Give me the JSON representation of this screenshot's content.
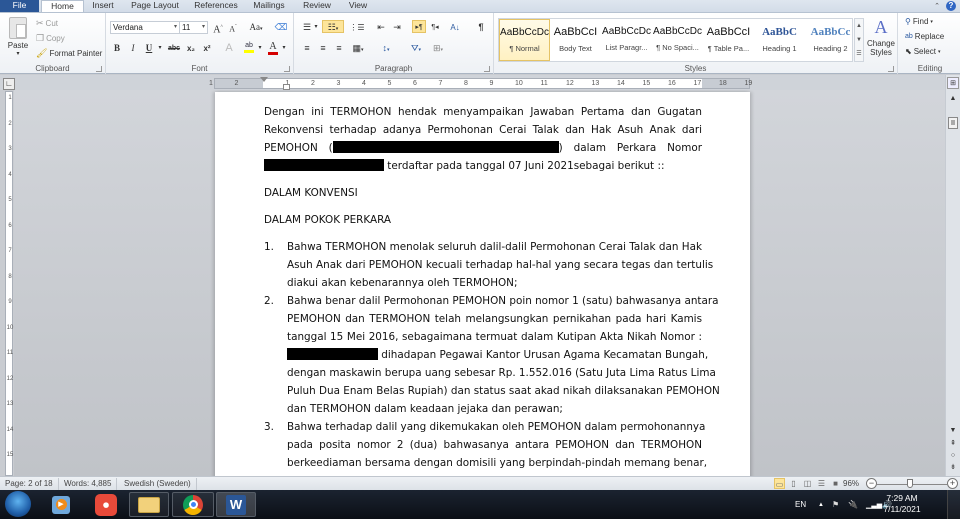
{
  "app": {
    "tabs": [
      {
        "label": "File"
      },
      {
        "label": "Home"
      },
      {
        "label": "Insert"
      },
      {
        "label": "Page Layout"
      },
      {
        "label": "References"
      },
      {
        "label": "Mailings"
      },
      {
        "label": "Review"
      },
      {
        "label": "View"
      }
    ],
    "active_tab": "Home",
    "accent_color": "#2b5797",
    "help_label": "?"
  },
  "ribbon": {
    "clipboard": {
      "label": "Clipboard",
      "paste": "Paste",
      "cut": "Cut",
      "copy": "Copy",
      "format_painter": "Format Painter"
    },
    "font": {
      "label": "Font",
      "font_name": "Verdana",
      "font_size": "11",
      "bold": "B",
      "italic": "I",
      "underline": "U",
      "strike": "abc",
      "subscript": "x₂",
      "superscript": "x²",
      "grow": "A",
      "shrink": "A",
      "change_case": "Aa",
      "highlight_color": "#ffff00",
      "font_color": "#d40000"
    },
    "paragraph": {
      "label": "Paragraph"
    },
    "styles": {
      "label": "Styles",
      "items": [
        {
          "preview": "AaBbCcDc",
          "name": "¶ Normal",
          "selected": true
        },
        {
          "preview": "AaBbCcI",
          "name": "Body Text"
        },
        {
          "preview": "AaBbCcDc",
          "name": "List Paragr..."
        },
        {
          "preview": "AaBbCcDc",
          "name": "¶ No Spaci..."
        },
        {
          "preview": "AaBbCcI",
          "name": "¶ Table Pa..."
        },
        {
          "preview": "AaBbC",
          "name": "Heading 1"
        },
        {
          "preview": "AaBbCc",
          "name": "Heading 2"
        }
      ],
      "change_styles": "Change Styles"
    },
    "editing": {
      "label": "Editing",
      "find": "Find",
      "replace": "Replace",
      "select": "Select"
    }
  },
  "ruler": {
    "h_numbers": [
      "1",
      "2",
      "1",
      "2",
      "3",
      "4",
      "5",
      "6",
      "7",
      "8",
      "9",
      "10",
      "11",
      "12",
      "13",
      "14",
      "15",
      "16",
      "17",
      "18",
      "19"
    ],
    "v_numbers": [
      "1",
      "2",
      "3",
      "4",
      "5",
      "6",
      "7",
      "8",
      "9",
      "10",
      "11",
      "12",
      "13",
      "14",
      "15"
    ]
  },
  "document": {
    "intro_lines": [
      "Dengan ini TERMOHON hendak menyampaikan Jawaban Pertama dan Gugatan",
      "Rekonvensi terhadap adanya Permohonan Cerai Talak dan Hak Asuh Anak dari"
    ],
    "intro_line3_before": "PEMOHON (",
    "intro_line3_after": ") dalam Perkara Nomor",
    "intro_line4_after": " terdaftar pada tanggal 07 Juni 2021sebagai berikut ::",
    "heading1": "DALAM KONVENSI",
    "heading2": "DALAM POKOK PERKARA",
    "items": [
      {
        "num": "1.",
        "lines": [
          "Bahwa TERMOHON menolak seluruh dalil-dalil Permohonan Cerai Talak dan Hak",
          "Asuh Anak dari PEMOHON kecuali terhadap hal-hal yang secara tegas dan tertulis",
          "diakui akan kebenarannya oleh TERMOHON;"
        ]
      },
      {
        "num": "2.",
        "lines": [
          "Bahwa benar dalil Permohonan PEMOHON poin nomor 1 (satu) bahwasanya antara",
          "PEMOHON dan TERMOHON telah melangsungkan pernikahan pada hari Kamis",
          "tanggal 15 Mei 2016, sebagaimana termuat dalam Kutipan Akta Nikah Nomor :"
        ],
        "redacted_line_after": " dihadapan Pegawai Kantor Urusan Agama Kecamatan Bungah,",
        "lines_after": [
          "dengan maskawin berupa uang sebesar Rp. 1.552.016 (Satu Juta Lima Ratus Lima",
          "Puluh Dua Enam Belas Rupiah) dan status saat akad nikah dilaksanakan PEMOHON",
          "dan TERMOHON dalam keadaan jejaka dan perawan;"
        ]
      },
      {
        "num": "3.",
        "lines": [
          "Bahwa terhadap dalil yang dikemukakan oleh PEMOHON dalam permohonannya",
          "pada posita nomor 2 (dua) bahwasanya antara PEMOHON dan TERMOHON",
          "berkeediaman bersama dengan domisili yang berpindah-pindah memang benar,"
        ]
      }
    ]
  },
  "status_bar": {
    "page": "Page: 2 of 18",
    "words": "Words: 4,885",
    "language": "Swedish (Sweden)",
    "zoom": "96%",
    "zoom_percent": 96
  },
  "taskbar": {
    "apps": [
      "Start",
      "Media Player",
      "Screen Recorder",
      "Windows Explorer",
      "Google Chrome",
      "Microsoft Word"
    ],
    "language": "EN",
    "time": "7:29 AM",
    "date": "7/11/2021"
  }
}
